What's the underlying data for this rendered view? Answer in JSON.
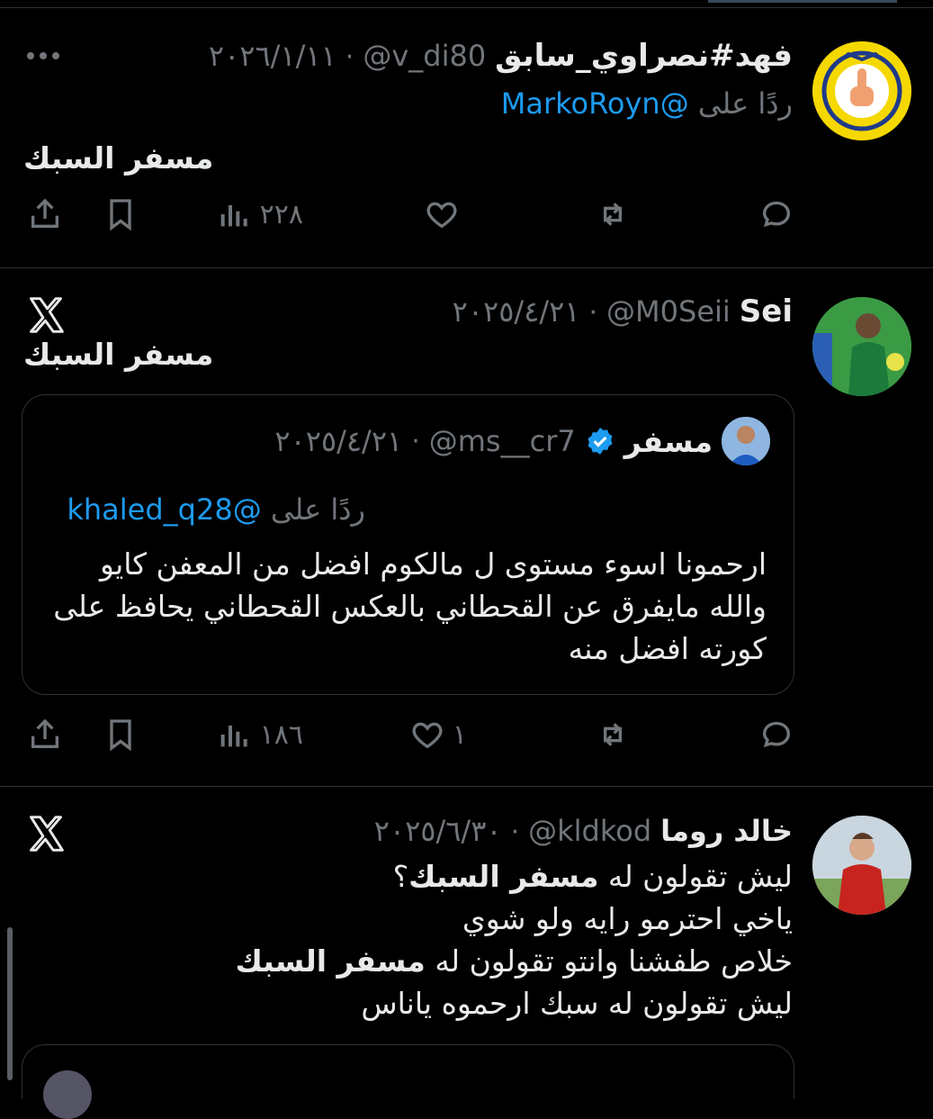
{
  "tweets": [
    {
      "name": "فهد#نصراوي_سابق",
      "handle": "@v_di80",
      "date": "٢٠٢٦/١/١١",
      "replying_prefix": "ردًا على",
      "replying_to": "@MarkoRoyn",
      "text": "مسفر السبك",
      "views": "٢٢٨",
      "likes": "",
      "more_icon": "more-dots-icon"
    },
    {
      "name": "Sei",
      "handle": "@M0Seii",
      "date": "٢٠٢٥/٤/٢١",
      "text": "مسفر السبك",
      "views": "١٨٦",
      "likes": "١",
      "quote": {
        "name": "مسفر",
        "handle": "@ms__cr7",
        "date": "٢٠٢٥/٤/٢١",
        "replying_prefix": "ردًا على",
        "replying_to": "@khaled_q28",
        "lines": [
          "ارحمونا اسوء مستوى ل مالكوم افضل من المعفن كايو",
          "والله مايفرق عن القحطاني بالعكس القحطاني يحافظ على",
          "كورته افضل منه"
        ]
      }
    },
    {
      "name": "خالد روما",
      "handle": "@kldkod",
      "date": "٢٠٢٥/٦/٣٠",
      "line1_pre": "ليش تقولون له ",
      "line1_bold": "مسفر السبك",
      "line1_post": "؟",
      "line2": "ياخي احترمو رايه ولو شوي",
      "line3_pre": "خلاص طفشنا وانتو تقولون له ",
      "line3_bold": "مسفر السبك",
      "line4": "ليش تقولون له سبك ارحموه ياناس"
    }
  ],
  "colors": {
    "background": "#000000",
    "text": "#e7e9ea",
    "muted": "#71767b",
    "link": "#1d9bf0",
    "border": "#2f3336"
  }
}
